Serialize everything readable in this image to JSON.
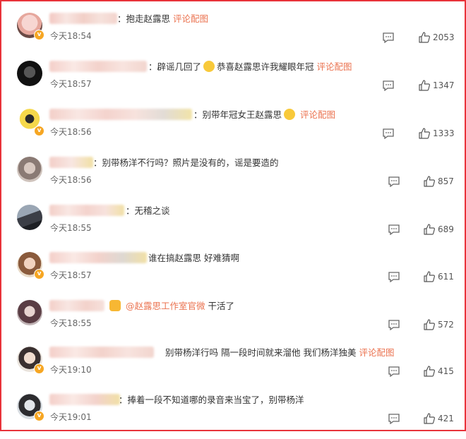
{
  "comments": [
    {
      "text": "：抱走赵露思",
      "link": "评论配图",
      "time": "今天18:54",
      "likes": "2053"
    },
    {
      "text_before": "：辟谣几回了",
      "text_after": "恭喜赵露思许我耀眼年冠",
      "link": "评论配图",
      "time": "今天18:57",
      "likes": "1347"
    },
    {
      "text": "：别带年冠女王赵露思",
      "link": "评论配图",
      "time": "今天18:56",
      "likes": "1333"
    },
    {
      "text": "：别带杨洋不行吗？照片是没有的，谣是要造的",
      "time": "今天18:56",
      "likes": "857"
    },
    {
      "text": "：无稽之谈",
      "time": "今天18:55",
      "likes": "689"
    },
    {
      "text": "谁在搞赵露思 好难猜啊",
      "time": "今天18:57",
      "likes": "611"
    },
    {
      "mention": "@赵露思工作室官微",
      "text": "干活了",
      "time": "今天18:55",
      "likes": "572"
    },
    {
      "text": "别带杨洋行吗 隔一段时间就来溜他 我们杨洋独美",
      "link": "评论配图",
      "time": "今天19:10",
      "likes": "415"
    },
    {
      "text": "：捧着一段不知道哪的录音来当宝了，别带杨洋",
      "time": "今天19:01",
      "likes": "421"
    }
  ],
  "icons": {
    "comment": "comment-bubble-icon",
    "like": "thumbs-up-icon",
    "verified": "vip-badge-icon"
  },
  "colors": {
    "border": "#e8333a",
    "link": "#eb7350",
    "badge": "#f6a623"
  }
}
